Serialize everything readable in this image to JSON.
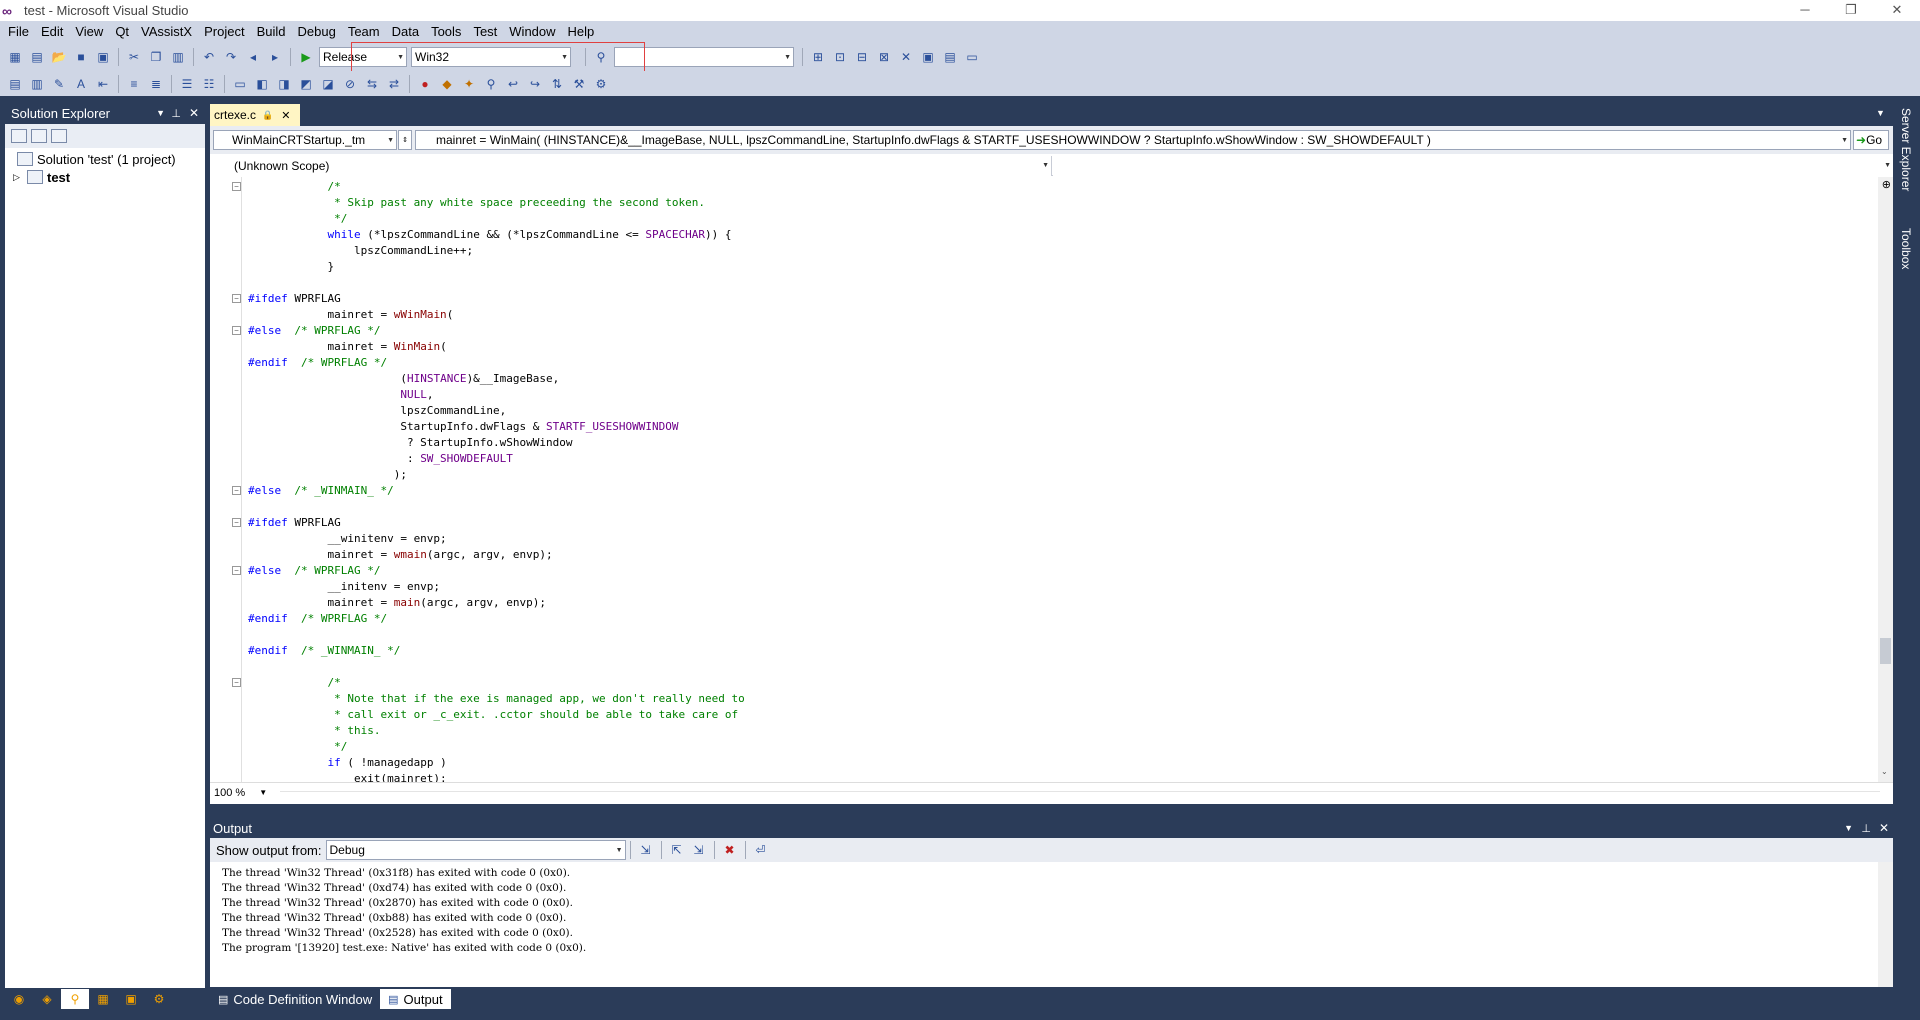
{
  "window": {
    "title": "test - Microsoft Visual Studio",
    "minimize": "─",
    "restore": "❐",
    "close": "✕"
  },
  "menu": [
    "File",
    "Edit",
    "View",
    "Qt",
    "VAssistX",
    "Project",
    "Build",
    "Debug",
    "Team",
    "Data",
    "Tools",
    "Test",
    "Window",
    "Help"
  ],
  "toolbar": {
    "configuration": "Release",
    "platform": "Win32",
    "find_value": ""
  },
  "solution_explorer": {
    "title": "Solution Explorer",
    "solution_label": "Solution 'test' (1 project)",
    "project_label": "test"
  },
  "editor": {
    "tab": "crtexe.c",
    "function_combo": "WinMainCRTStartup._tm",
    "member_combo": "mainret = WinMain( (HINSTANCE)&__ImageBase, NULL, lpszCommandLine, StartupInfo.dwFlags & STARTF_USESHOWWINDOW ? StartupInfo.wShowWindow : SW_SHOWDEFAULT )",
    "go_label": "Go",
    "scope": "(Unknown Scope)",
    "zoom": "100 %",
    "lines": [
      "            /*",
      "             * Skip past any white space preceeding the second token.",
      "             */",
      "            while (*lpszCommandLine && (*lpszCommandLine <= SPACECHAR)) {",
      "                lpszCommandLine++;",
      "            }",
      "",
      "#ifdef WPRFLAG",
      "            mainret = wWinMain(",
      "#else  /* WPRFLAG */",
      "            mainret = WinMain(",
      "#endif  /* WPRFLAG */",
      "                       (HINSTANCE)&__ImageBase,",
      "                       NULL,",
      "                       lpszCommandLine,",
      "                       StartupInfo.dwFlags & STARTF_USESHOWWINDOW",
      "                        ? StartupInfo.wShowWindow",
      "                        : SW_SHOWDEFAULT",
      "                      );",
      "#else  /* _WINMAIN_ */",
      "",
      "#ifdef WPRFLAG",
      "            __winitenv = envp;",
      "            mainret = wmain(argc, argv, envp);",
      "#else  /* WPRFLAG */",
      "            __initenv = envp;",
      "            mainret = main(argc, argv, envp);",
      "#endif  /* WPRFLAG */",
      "",
      "#endif  /* _WINMAIN_ */",
      "",
      "            /*",
      "             * Note that if the exe is managed app, we don't really need to",
      "             * call exit or _c_exit. .cctor should be able to take care of",
      "             * this.",
      "             */",
      "            if ( !managedapp )",
      "                exit(mainret);"
    ]
  },
  "output": {
    "title": "Output",
    "show_from_label": "Show output from:",
    "show_from_value": "Debug",
    "lines": [
      "The thread 'Win32 Thread' (0x31f8) has exited with code 0 (0x0).",
      "The thread 'Win32 Thread' (0xd74) has exited with code 0 (0x0).",
      "The thread 'Win32 Thread' (0x2870) has exited with code 0 (0x0).",
      "The thread 'Win32 Thread' (0xb88) has exited with code 0 (0x0).",
      "The thread 'Win32 Thread' (0x2528) has exited with code 0 (0x0).",
      "The program '[13920] test.exe: Native' has exited with code 0 (0x0)."
    ]
  },
  "bottom_tabs": {
    "code_def": "Code Definition Window",
    "output": "Output"
  },
  "right_strip": {
    "server_explorer": "Server Explorer",
    "toolbox": "Toolbox"
  }
}
